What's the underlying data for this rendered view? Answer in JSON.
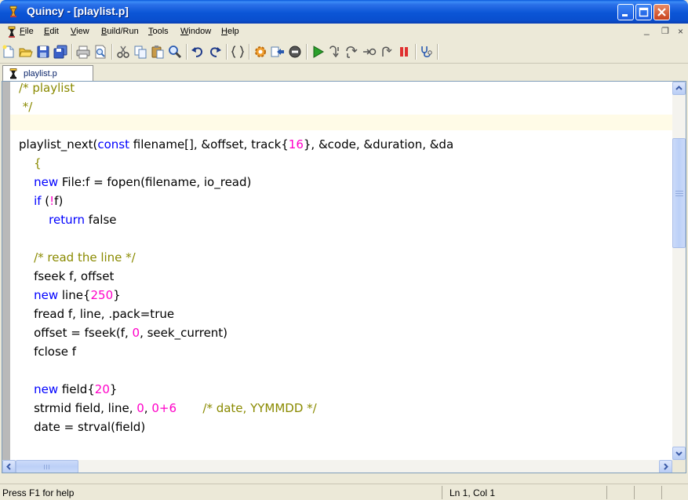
{
  "window": {
    "title": "Quincy - [playlist.p]"
  },
  "menu": [
    {
      "label": "File"
    },
    {
      "label": "Edit"
    },
    {
      "label": "View"
    },
    {
      "label": "Build/Run"
    },
    {
      "label": "Tools"
    },
    {
      "label": "Window"
    },
    {
      "label": "Help"
    }
  ],
  "tab": {
    "label": "playlist.p"
  },
  "code": {
    "lines": [
      [
        {
          "t": "/* playlist",
          "c": "cm"
        }
      ],
      [
        {
          "t": " */",
          "c": "cm"
        }
      ],
      [],
      [
        {
          "t": "playlist_next("
        },
        {
          "t": "const",
          "c": "kw"
        },
        {
          "t": " filename[], &offset, track{"
        },
        {
          "t": "16",
          "c": "num"
        },
        {
          "t": "}, &code, &duration, &da"
        }
      ],
      [
        {
          "t": "    {",
          "c": "cm"
        }
      ],
      [
        {
          "t": "    "
        },
        {
          "t": "new",
          "c": "kw"
        },
        {
          "t": " File:f = fopen(filename, io_read)"
        }
      ],
      [
        {
          "t": "    "
        },
        {
          "t": "if",
          "c": "kw"
        },
        {
          "t": " ("
        },
        {
          "t": "!",
          "c": "num"
        },
        {
          "t": "f)"
        }
      ],
      [
        {
          "t": "        "
        },
        {
          "t": "return",
          "c": "kw"
        },
        {
          "t": " false"
        }
      ],
      [],
      [
        {
          "t": "    /* read the line */",
          "c": "cm"
        }
      ],
      [
        {
          "t": "    fseek f, offset"
        }
      ],
      [
        {
          "t": "    "
        },
        {
          "t": "new",
          "c": "kw"
        },
        {
          "t": " line{"
        },
        {
          "t": "250",
          "c": "num"
        },
        {
          "t": "}"
        }
      ],
      [
        {
          "t": "    fread f, line, .pack=true"
        }
      ],
      [
        {
          "t": "    offset = fseek(f, "
        },
        {
          "t": "0",
          "c": "num"
        },
        {
          "t": ", seek_current)"
        }
      ],
      [
        {
          "t": "    fclose f"
        }
      ],
      [],
      [
        {
          "t": "    "
        },
        {
          "t": "new",
          "c": "kw"
        },
        {
          "t": " field{"
        },
        {
          "t": "20",
          "c": "num"
        },
        {
          "t": "}"
        }
      ],
      [
        {
          "t": "    strmid field, line, "
        },
        {
          "t": "0",
          "c": "num"
        },
        {
          "t": ", "
        },
        {
          "t": "0+6",
          "c": "num"
        },
        {
          "t": "       "
        },
        {
          "t": "/* date, YYMMDD */",
          "c": "cm"
        }
      ],
      [
        {
          "t": "    date = strval(field)"
        }
      ]
    ]
  },
  "status": {
    "help_text": "Press F1 for help",
    "position": "Ln 1, Col 1"
  }
}
